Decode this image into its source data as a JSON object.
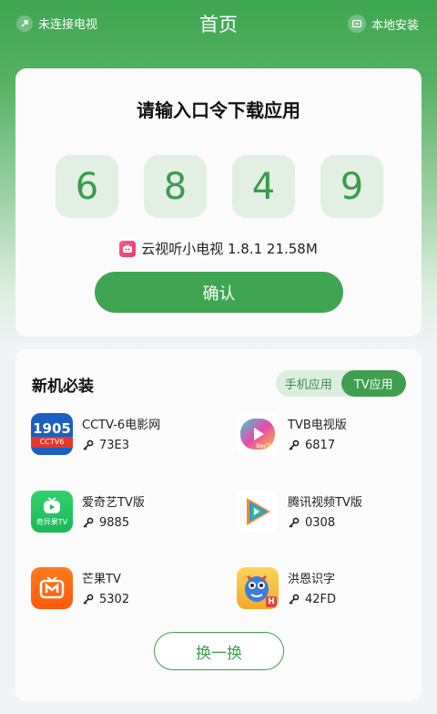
{
  "header": {
    "tv_status": "未连接电视",
    "title": "首页",
    "local_install": "本地安装"
  },
  "code_entry": {
    "title": "请输入口令下载应用",
    "digits": [
      "6",
      "8",
      "4",
      "9"
    ],
    "app_name_version_size": "云视听小电视 1.8.1 21.58M",
    "confirm_label": "确认"
  },
  "apps_section": {
    "title": "新机必装",
    "tabs": [
      {
        "label": "手机应用",
        "active": false
      },
      {
        "label": "TV应用",
        "active": true
      }
    ],
    "apps": [
      {
        "name": "CCTV-6电影网",
        "code": "73E3",
        "icon": "cctv6-app-icon",
        "icon_text": "1905",
        "icon_subtext": "CCTV6"
      },
      {
        "name": "TVB电视版",
        "code": "6817",
        "icon": "tvb-app-icon",
        "icon_text": "BesTV"
      },
      {
        "name": "爱奇艺TV版",
        "code": "9885",
        "icon": "iqiyi-app-icon",
        "icon_text": "奇异果TV"
      },
      {
        "name": "腾讯视频TV版",
        "code": "0308",
        "icon": "tencent-video-app-icon"
      },
      {
        "name": "芒果TV",
        "code": "5302",
        "icon": "mango-tv-app-icon"
      },
      {
        "name": "洪恩识字",
        "code": "42FD",
        "icon": "hongen-app-icon",
        "icon_text": "H"
      }
    ],
    "refresh_label": "换一换"
  },
  "colors": {
    "accent": "#40a552",
    "digit_bg": "#e2efe3",
    "card_bg": "#fbfbfb"
  }
}
